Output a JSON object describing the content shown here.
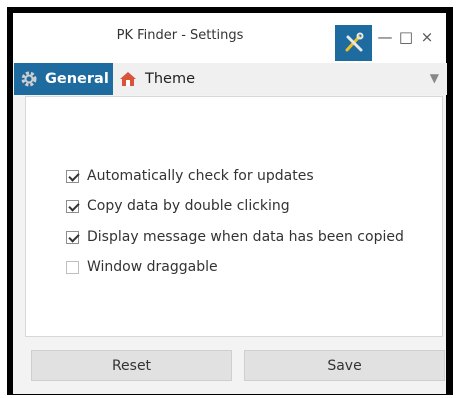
{
  "window": {
    "title": "PK Finder - Settings",
    "accent_color": "#1e6ba0"
  },
  "title_controls": {
    "tools_icon": "wrench-screwdriver-icon",
    "minimize": "—",
    "maximize": "□",
    "close": "×"
  },
  "tabs": [
    {
      "label": "General",
      "icon": "gear-icon",
      "selected": true
    },
    {
      "label": "Theme",
      "icon": "house-icon",
      "selected": false
    }
  ],
  "tabbar": {
    "dropdown_arrow": "▼"
  },
  "options": [
    {
      "label": "Automatically check for updates",
      "checked": true
    },
    {
      "label": "Copy data by double clicking",
      "checked": true
    },
    {
      "label": "Display message when data has been copied",
      "checked": true
    },
    {
      "label": "Window draggable",
      "checked": false
    }
  ],
  "buttons": {
    "reset": "Reset",
    "save": "Save"
  }
}
